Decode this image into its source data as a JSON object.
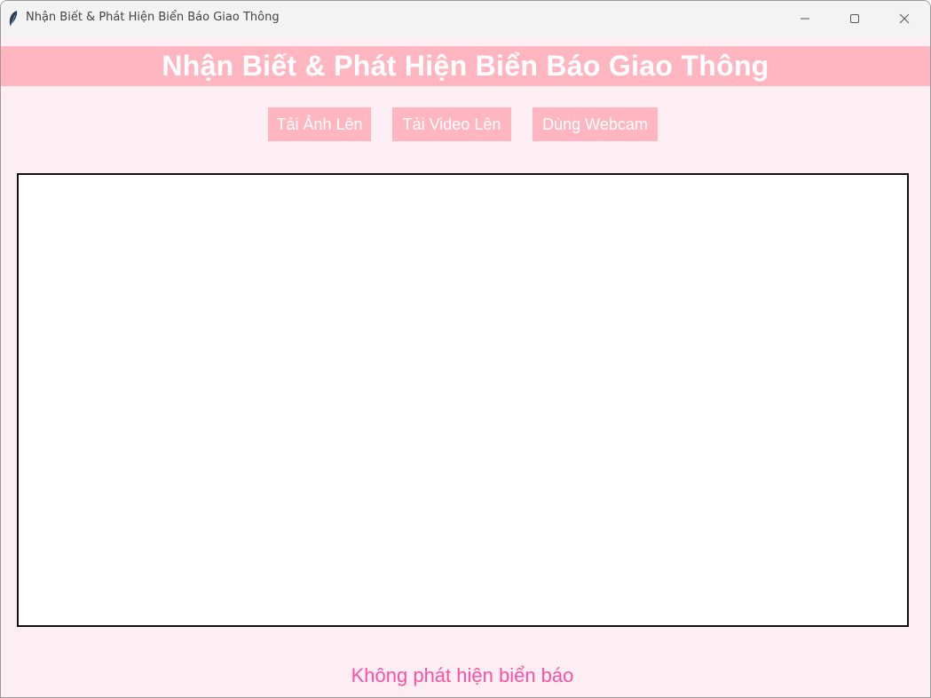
{
  "window": {
    "title": "Nhận Biết & Phát Hiện Biển Báo Giao Thông",
    "icon": "feather-icon",
    "controls": {
      "minimize_icon": "minimize-icon",
      "maximize_icon": "maximize-icon",
      "close_icon": "close-icon"
    }
  },
  "header": {
    "title": "Nhận Biết & Phát Hiện Biển Báo Giao Thông"
  },
  "toolbar": {
    "upload_image_label": "Tải Ảnh Lên",
    "upload_video_label": "Tải Video Lên",
    "webcam_label": "Dùng Webcam"
  },
  "status": {
    "message": "Không phát hiện biển báo"
  },
  "colors": {
    "background": "#fdeef3",
    "accent": "#ffb6c1",
    "button_text": "#ffffff",
    "status_text": "#ff4fa3",
    "canvas_border": "#111111"
  }
}
